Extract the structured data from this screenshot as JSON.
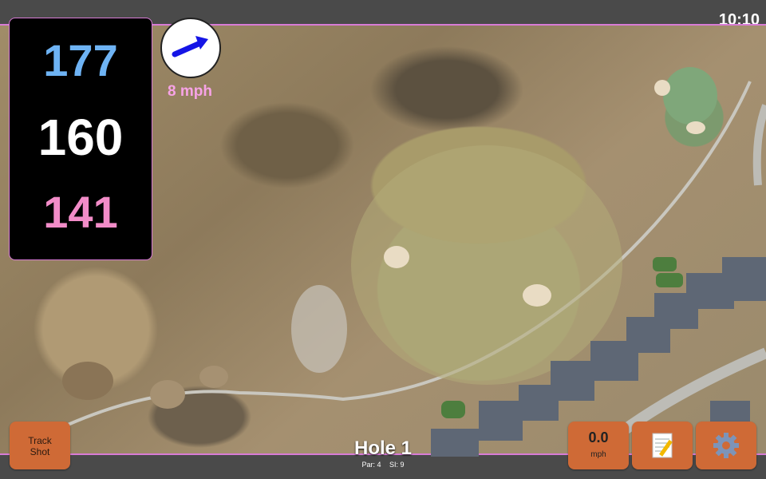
{
  "status": {
    "time": "10:10"
  },
  "distances": {
    "back": "177",
    "middle": "160",
    "front": "141"
  },
  "wind": {
    "speed_text": "8 mph",
    "arrow_icon": "arrow-right-icon"
  },
  "hole": {
    "title": "Hole 1",
    "par": "Par: 4",
    "stroke_index": "SI: 9"
  },
  "buttons": {
    "track_shot_line1": "Track",
    "track_shot_line2": "Shot",
    "speed_value": "0.0",
    "speed_unit": "mph",
    "notes_icon": "notepad-icon",
    "settings_icon": "gear-icon"
  },
  "colors": {
    "back": "#6eb3f4",
    "middle": "#ffffff",
    "front": "#f28cc8",
    "wind_text": "#f7a3e6",
    "button": "#cf6a36"
  }
}
